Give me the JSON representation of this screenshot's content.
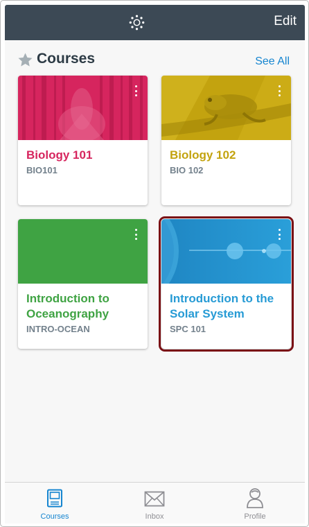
{
  "header": {
    "edit_label": "Edit"
  },
  "courses_section": {
    "title": "Courses",
    "see_all_label": "See All"
  },
  "courses": [
    {
      "title": "Biology 101",
      "code": "BIO101",
      "color": "#d6255e"
    },
    {
      "title": "Biology 102",
      "code": "BIO 102",
      "color": "#c3a30f"
    },
    {
      "title": "Introduction to Oceanography",
      "code": "INTRO-OCEAN",
      "color": "#3fa343"
    },
    {
      "title": "Introduction to the Solar System",
      "code": "SPC 101",
      "color": "#279bd5"
    }
  ],
  "tabbar": {
    "tabs": [
      {
        "label": "Courses",
        "active": true,
        "icon": "book-icon"
      },
      {
        "label": "Inbox",
        "active": false,
        "icon": "envelope-icon"
      },
      {
        "label": "Profile",
        "active": false,
        "icon": "person-icon"
      }
    ]
  },
  "colors": {
    "navbar": "#3c4955",
    "accent": "#1585d0",
    "selected_outline": "#7a1015"
  }
}
